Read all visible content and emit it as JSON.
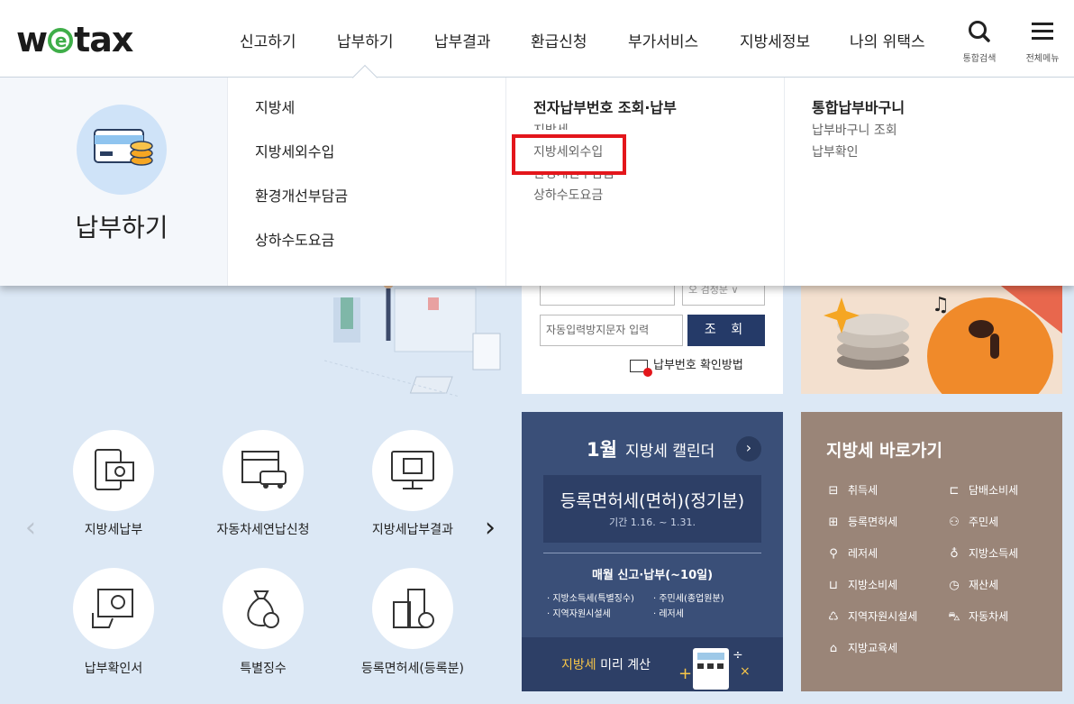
{
  "logo": {
    "pre": "w",
    "mid": "e",
    "post": "tax"
  },
  "nav": {
    "items": [
      "신고하기",
      "납부하기",
      "납부결과",
      "환급신청",
      "부가서비스",
      "지방세정보",
      "나의 위택스"
    ]
  },
  "tools": {
    "search_label": "통합검색",
    "menu_label": "전체메뉴"
  },
  "mega": {
    "title": "납부하기",
    "col1": [
      "지방세",
      "지방세외수입",
      "환경개선부담금",
      "상하수도요금"
    ],
    "col2": {
      "head": "전자납부번호 조회·납부",
      "items": [
        "지방세",
        "지방세외수입",
        "환경개선부담금",
        "상하수도요금"
      ]
    },
    "col3": {
      "head": "통합납부바구니",
      "items": [
        "납부바구니 조회",
        "납부확인"
      ]
    }
  },
  "lookup": {
    "captcha_placeholder": "자동입력방지문자 입력",
    "button": "조 회",
    "partial_button": "오 검정문 ∨",
    "help": "납부번호 확인방법"
  },
  "quick": {
    "items": [
      "지방세납부",
      "자동차세연납신청",
      "지방세납부결과",
      "납부확인서",
      "특별징수",
      "등록면허세(등록분)"
    ]
  },
  "calendar": {
    "month": "1월",
    "title": "지방세 캘린더",
    "main_event": "등록면허세(면허)(정기분)",
    "period": "기간 1.16. ~ 1.31.",
    "monthly_title": "매월 신고·납부(~10일)",
    "monthly_items": [
      "지방소득세(특별징수)",
      "주민세(종업원분)",
      "지역자원시설세",
      "레저세"
    ],
    "calc_pre": "지방세",
    "calc_post": " 미리 계산"
  },
  "shortcut": {
    "title": "지방세 바로가기",
    "left": [
      "취득세",
      "등록면허세",
      "레저세",
      "지방소비세",
      "지역자원시설세",
      "지방교육세"
    ],
    "right": [
      "담배소비세",
      "주민세",
      "지방소득세",
      "재산세",
      "자동차세"
    ]
  },
  "colors": {
    "accent_navy": "#253a68",
    "highlight_red": "#e3161b",
    "logo_green": "#3fae49",
    "calendar_bg": "#3a4f78",
    "shortcut_bg": "#9a8578"
  }
}
